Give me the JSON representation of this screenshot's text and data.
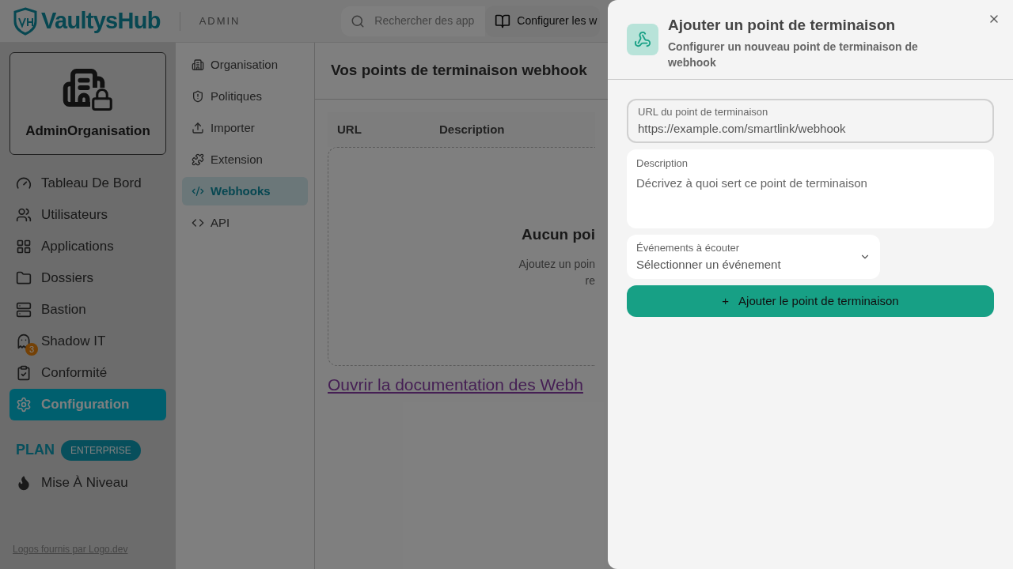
{
  "header": {
    "logo": "VaultysHub",
    "section": "ADMIN",
    "search": {
      "placeholder": "Rechercher des app"
    },
    "docs_button": "Configurer les w"
  },
  "sidebar": {
    "org_card": {
      "name": "AdminOrganisation"
    },
    "items": [
      {
        "label": "Tableau De Bord",
        "selected": false
      },
      {
        "label": "Utilisateurs",
        "selected": false
      },
      {
        "label": "Applications",
        "selected": false
      },
      {
        "label": "Dossiers",
        "selected": false
      },
      {
        "label": "Bastion",
        "selected": false
      },
      {
        "label": "Shadow IT",
        "selected": false,
        "badge": "3"
      },
      {
        "label": "Conformité",
        "selected": false
      },
      {
        "label": "Configuration",
        "selected": true
      }
    ],
    "plan": {
      "label": "PLAN",
      "tier": "ENTERPRISE"
    },
    "upgrade": "Mise À Niveau",
    "footer_link": "Logos fournis par Logo.dev"
  },
  "subnav": {
    "items": [
      {
        "label": "Organisation",
        "selected": false
      },
      {
        "label": "Politiques",
        "selected": false
      },
      {
        "label": "Importer",
        "selected": false
      },
      {
        "label": "Extension",
        "selected": false
      },
      {
        "label": "Webhooks",
        "selected": true
      },
      {
        "label": "API",
        "selected": false
      }
    ]
  },
  "main": {
    "title": "Vos points de terminaison webhook",
    "table": {
      "columns": [
        "URL",
        "Description"
      ]
    },
    "empty_state": {
      "title": "Aucun poi",
      "lines": [
        "Ajoutez un poin",
        "re"
      ]
    },
    "docs_link": "Ouvrir la documentation des Webh"
  },
  "drawer": {
    "title": "Ajouter un point de terminaison",
    "subtitle": "Configurer un nouveau point de terminaison de webhook",
    "url_field": {
      "label": "URL du point de terminaison",
      "value": "https://example.com/smartlink/webhook"
    },
    "description_field": {
      "label": "Description",
      "placeholder": "Décrivez à quoi sert ce point de terminaison"
    },
    "events_select": {
      "label": "Événements à écouter",
      "placeholder": "Sélectionner un événement"
    },
    "submit": {
      "icon": "+",
      "label": "Ajouter le point de terminaison"
    }
  }
}
